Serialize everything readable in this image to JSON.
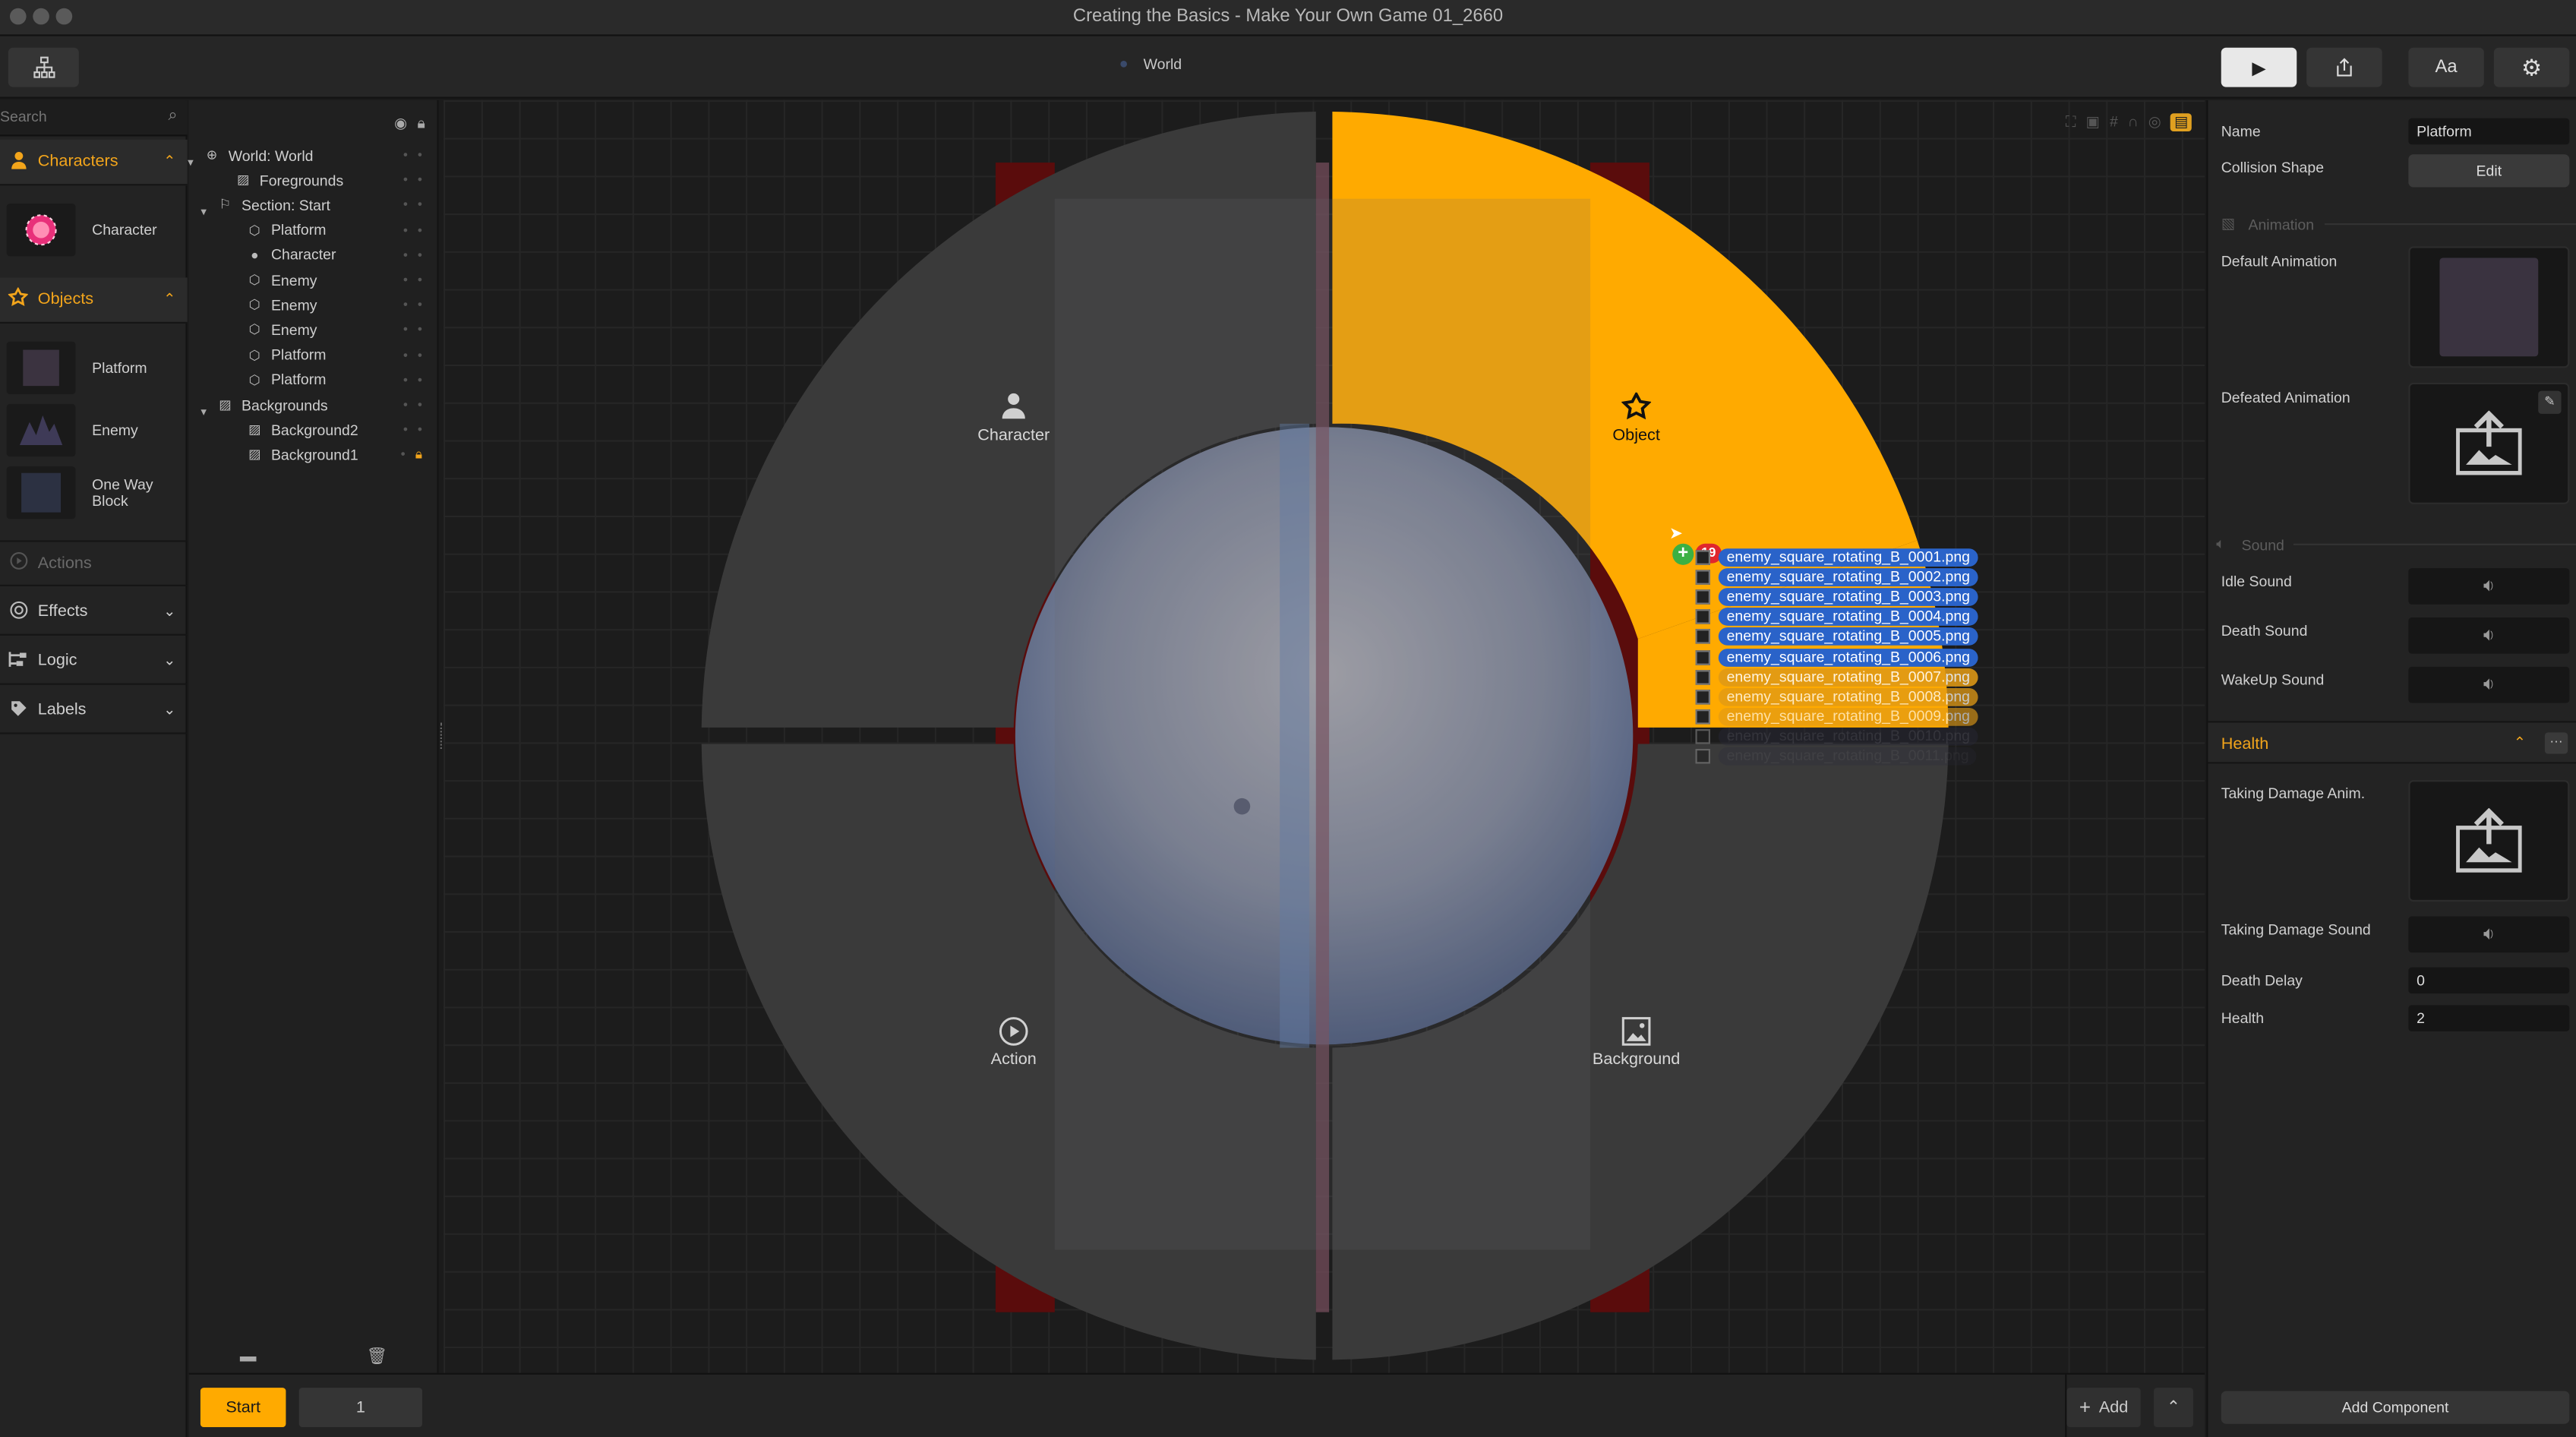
{
  "window": {
    "title": "Creating the Basics - Make Your Own Game 01_2660"
  },
  "toolbar": {
    "world_label": "World",
    "font_button": "Aa"
  },
  "left_sidebar": {
    "search_placeholder": "Search",
    "sections": {
      "characters": "Characters",
      "objects": "Objects",
      "actions": "Actions",
      "effects": "Effects",
      "logic": "Logic",
      "labels": "Labels"
    },
    "character_items": [
      "Character"
    ],
    "object_items": [
      "Platform",
      "Enemy",
      "One Way Block"
    ]
  },
  "hierarchy": {
    "rows": [
      {
        "label": "World: World",
        "icon": "globe-icon"
      },
      {
        "label": "Foregrounds",
        "icon": "image-icon"
      },
      {
        "label": "Section: Start",
        "icon": "flag-icon"
      },
      {
        "label": "Platform",
        "icon": "object-icon"
      },
      {
        "label": "Character",
        "icon": "person-icon"
      },
      {
        "label": "Enemy",
        "icon": "object-icon"
      },
      {
        "label": "Enemy",
        "icon": "object-icon"
      },
      {
        "label": "Enemy",
        "icon": "object-icon"
      },
      {
        "label": "Platform",
        "icon": "object-icon"
      },
      {
        "label": "Platform",
        "icon": "object-icon"
      },
      {
        "label": "Backgrounds",
        "icon": "image-icon"
      },
      {
        "label": "Background2",
        "icon": "image-icon"
      },
      {
        "label": "Background1",
        "icon": "image-icon"
      }
    ]
  },
  "radial_menu": {
    "character": "Character",
    "object": "Object",
    "action": "Action",
    "background": "Background",
    "highlight_color": "#FFAA00"
  },
  "drag": {
    "badge_count": "19",
    "files": [
      "enemy_square_rotating_B_0001.png",
      "enemy_square_rotating_B_0002.png",
      "enemy_square_rotating_B_0003.png",
      "enemy_square_rotating_B_0004.png",
      "enemy_square_rotating_B_0005.png",
      "enemy_square_rotating_B_0006.png",
      "enemy_square_rotating_B_0007.png",
      "enemy_square_rotating_B_0008.png",
      "enemy_square_rotating_B_0009.png",
      "enemy_square_rotating_B_0010.png",
      "enemy_square_rotating_B_0011.png"
    ]
  },
  "bottom_bar": {
    "section_button": "Start",
    "section_value": "1",
    "add_button": "Add"
  },
  "properties": {
    "name_label": "Name",
    "name_value": "Platform",
    "collision_label": "Collision Shape",
    "collision_button": "Edit",
    "animation_section": "Animation",
    "default_anim_label": "Default Animation",
    "defeated_anim_label": "Defeated Animation",
    "sound_section": "Sound",
    "idle_sound_label": "Idle Sound",
    "death_sound_label": "Death Sound",
    "wakeup_sound_label": "WakeUp Sound",
    "health_section": "Health",
    "taking_damage_anim_label": "Taking Damage Anim.",
    "taking_damage_sound_label": "Taking Damage Sound",
    "death_delay_label": "Death Delay",
    "death_delay_value": "0",
    "health_label": "Health",
    "health_value": "2",
    "add_component_button": "Add Component"
  },
  "colors": {
    "accent": "#F3A51B",
    "selection_blue": "#2A63C9",
    "selection_orange": "#E09A16",
    "badge_red": "#E0262D",
    "badge_green": "#3CB043"
  }
}
